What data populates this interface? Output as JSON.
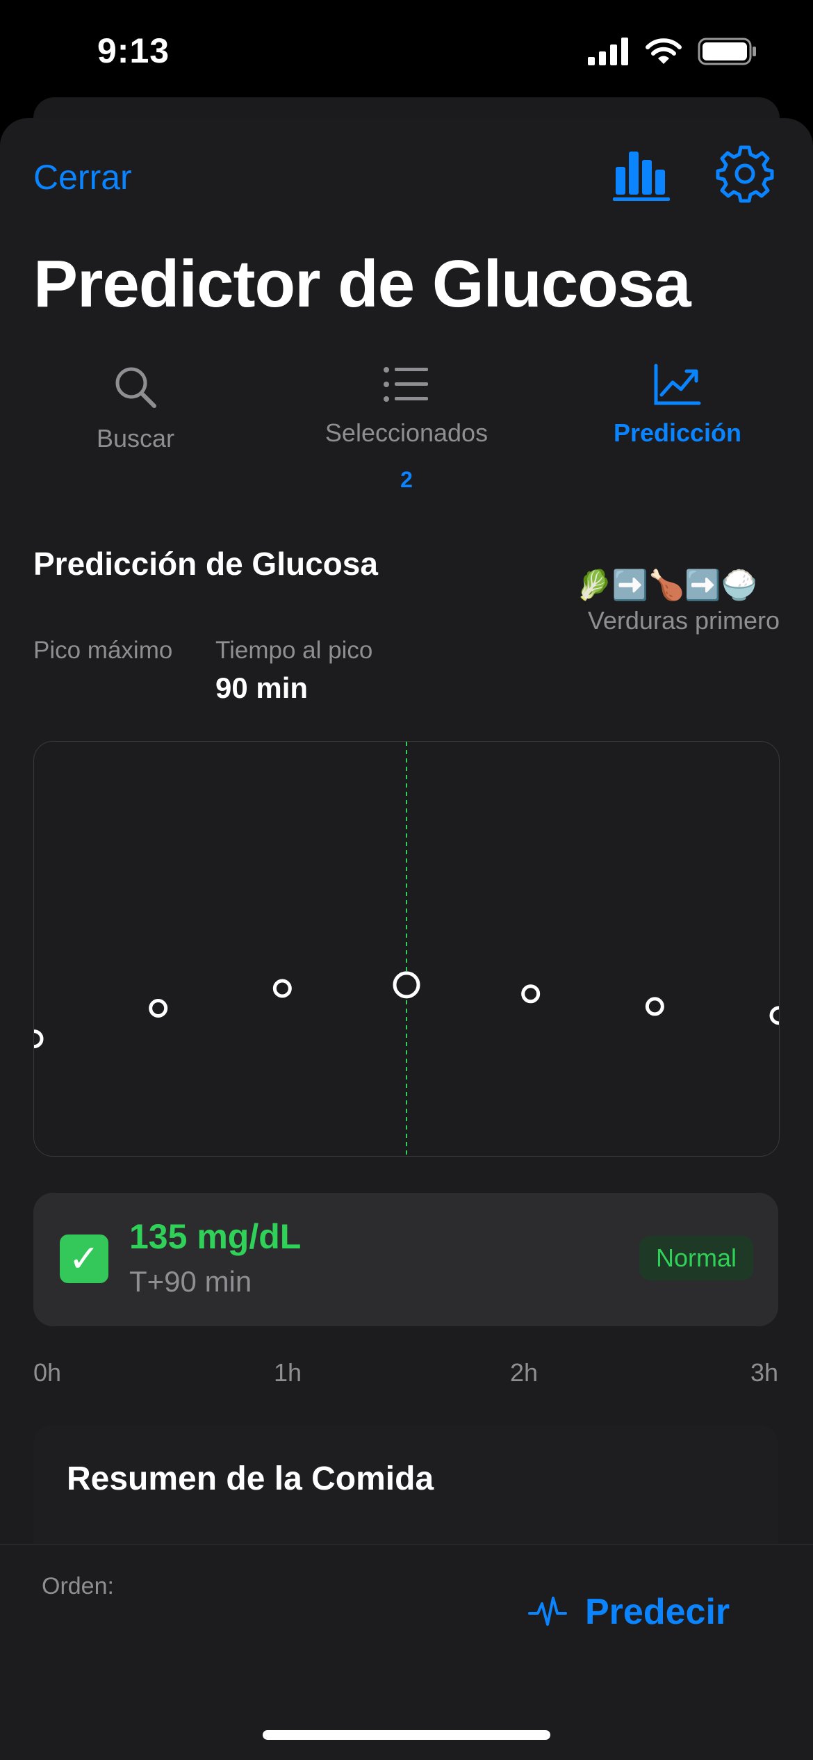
{
  "status": {
    "time": "9:13"
  },
  "header": {
    "close_label": "Cerrar",
    "title": "Predictor de Glucosa"
  },
  "tabs": [
    {
      "label": "Buscar",
      "icon": "search-icon",
      "active": false
    },
    {
      "label": "Seleccionados",
      "icon": "list-icon",
      "badge": "2",
      "active": false
    },
    {
      "label": "Predicción",
      "icon": "trend-chart-icon",
      "active": true
    }
  ],
  "prediction": {
    "title": "Predicción de Glucosa",
    "strategy_emoji": "🥬➡️🍗➡️🍚",
    "strategy_label": "Verduras primero",
    "peak_label": "Pico máximo",
    "time_to_peak_label": "Tiempo al pico",
    "time_to_peak_value": "90 min"
  },
  "chart_data": {
    "type": "scatter",
    "x_unit": "min",
    "x_ticks": [
      "0h",
      "1h",
      "2h",
      "3h"
    ],
    "xlim": [
      0,
      180
    ],
    "points": [
      {
        "x": 0,
        "y": 105
      },
      {
        "x": 30,
        "y": 122
      },
      {
        "x": 60,
        "y": 133
      },
      {
        "x": 90,
        "y": 135
      },
      {
        "x": 120,
        "y": 130
      },
      {
        "x": 150,
        "y": 123
      },
      {
        "x": 180,
        "y": 118
      }
    ],
    "selected_x": 90,
    "ylim": [
      40,
      270
    ],
    "selection_line_color": "#30d158"
  },
  "result": {
    "value": "135 mg/dL",
    "time": "T+90 min",
    "status": "Normal",
    "check_icon": "✓",
    "status_color": "#30d158"
  },
  "summary": {
    "title": "Resumen de la Comida"
  },
  "bottom": {
    "order_label": "Orden:",
    "predict_label": "Predecir"
  },
  "colors": {
    "accent": "#0a84ff",
    "success": "#30d158",
    "background": "#1c1c1e"
  }
}
